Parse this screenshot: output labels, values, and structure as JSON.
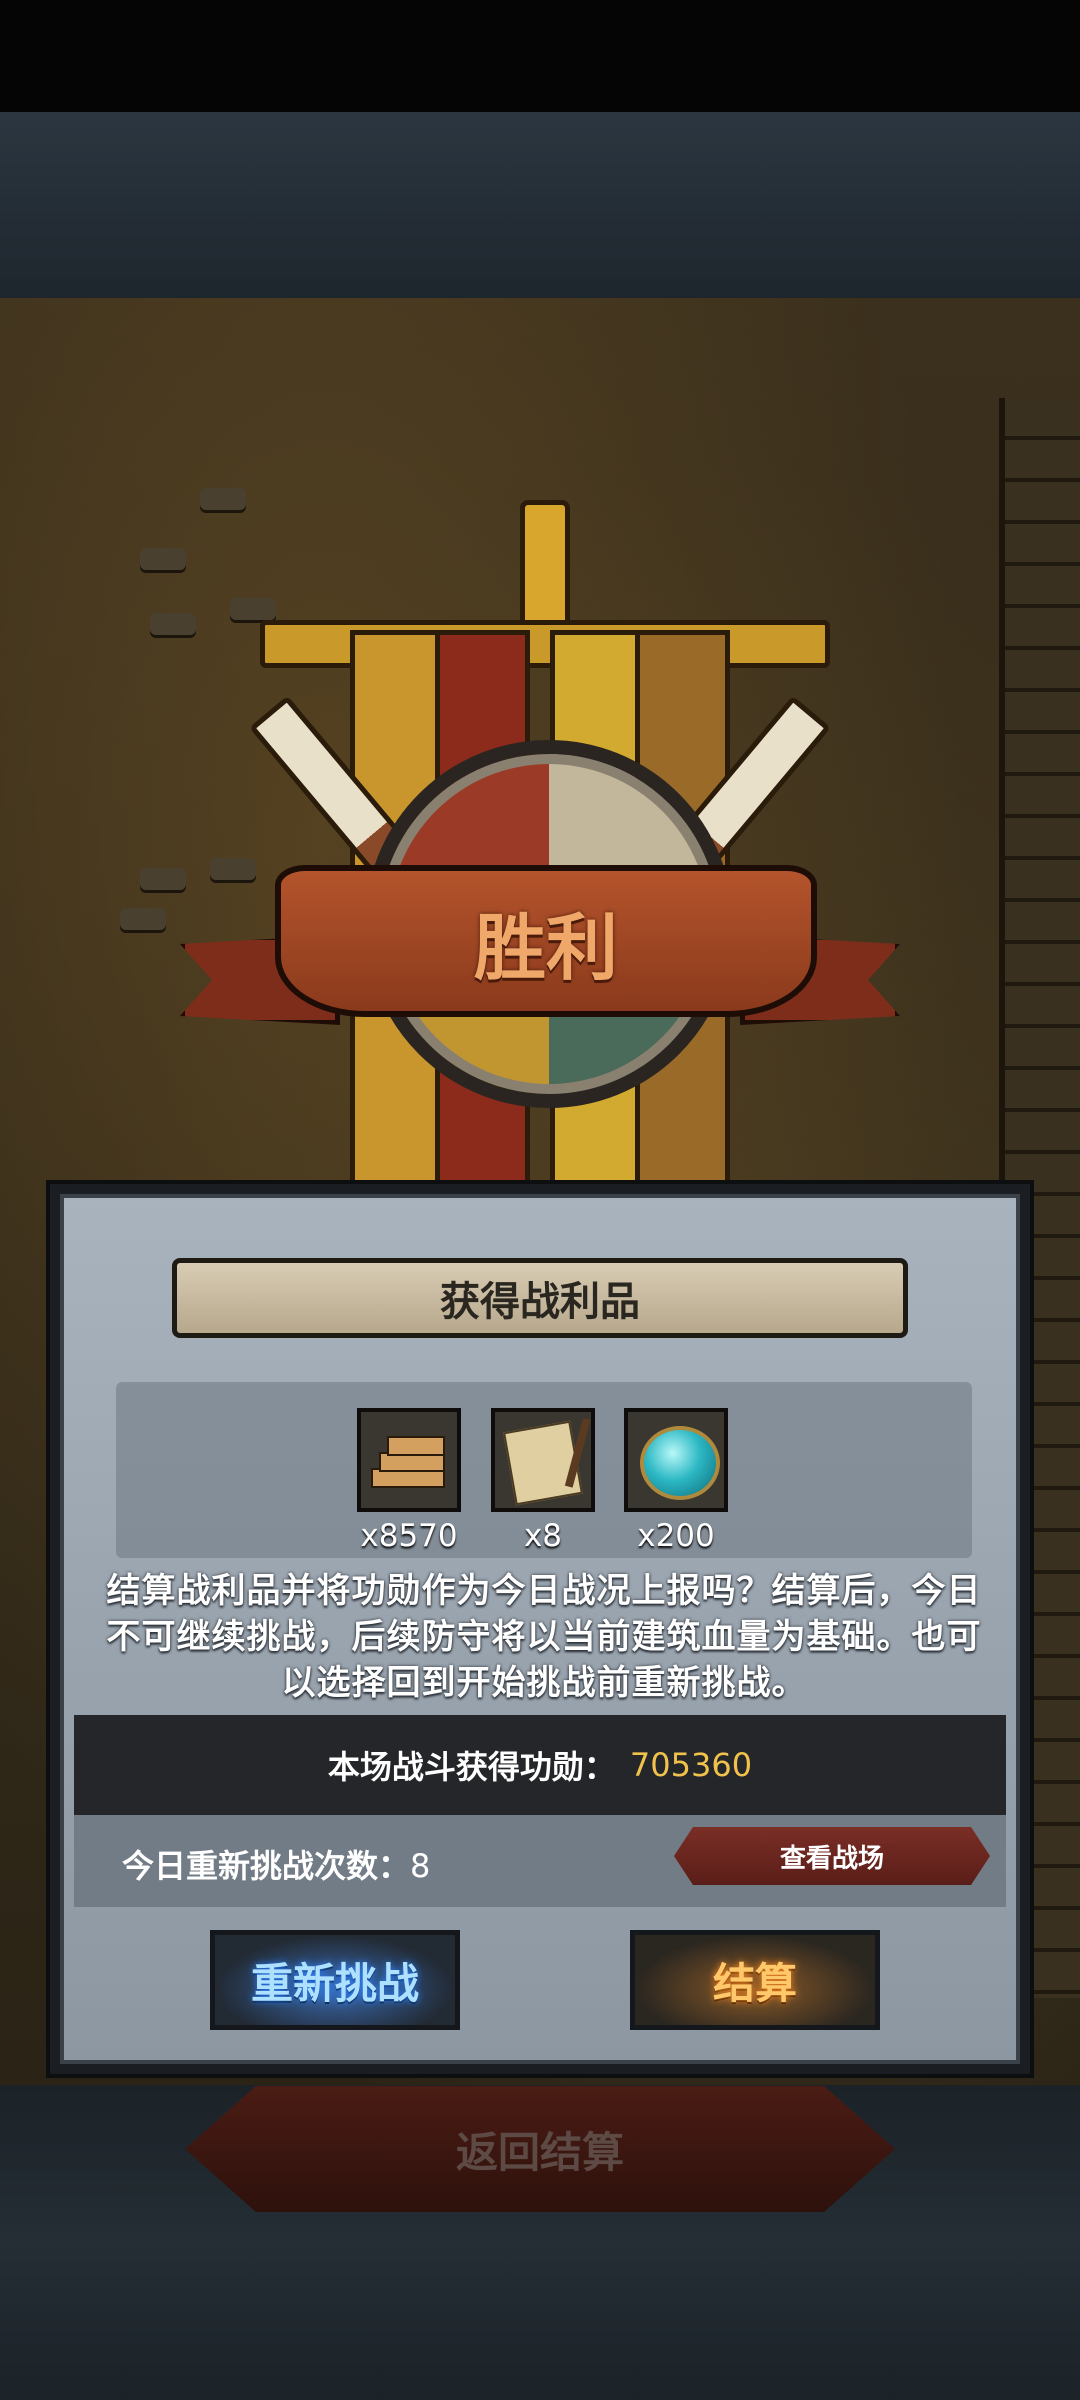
{
  "victory": {
    "title": "胜利"
  },
  "loot": {
    "header": "获得战利品",
    "rewards": [
      {
        "icon": "bricks-icon",
        "count": "x8570"
      },
      {
        "icon": "scroll-quill-icon",
        "count": "x8"
      },
      {
        "icon": "gem-icon",
        "count": "x200"
      }
    ],
    "description": "结算战利品并将功勋作为今日战况上报吗？结算后，今日不可继续挑战，后续防守将以当前建筑血量为基础。也可以选择回到开始挑战前重新挑战。"
  },
  "merit": {
    "label": "本场战斗获得功勋：",
    "value": "705360"
  },
  "retry": {
    "label": "今日重新挑战次数：",
    "count": "8",
    "view_battlefield": "查看战场"
  },
  "buttons": {
    "retry": "重新挑战",
    "settle": "结算"
  },
  "footer": {
    "return_settle": "返回结算"
  },
  "colors": {
    "merit_value": "#f0c24c",
    "retry_button_glow": "#2a80ff",
    "settle_button_glow": "#ff8a20"
  }
}
